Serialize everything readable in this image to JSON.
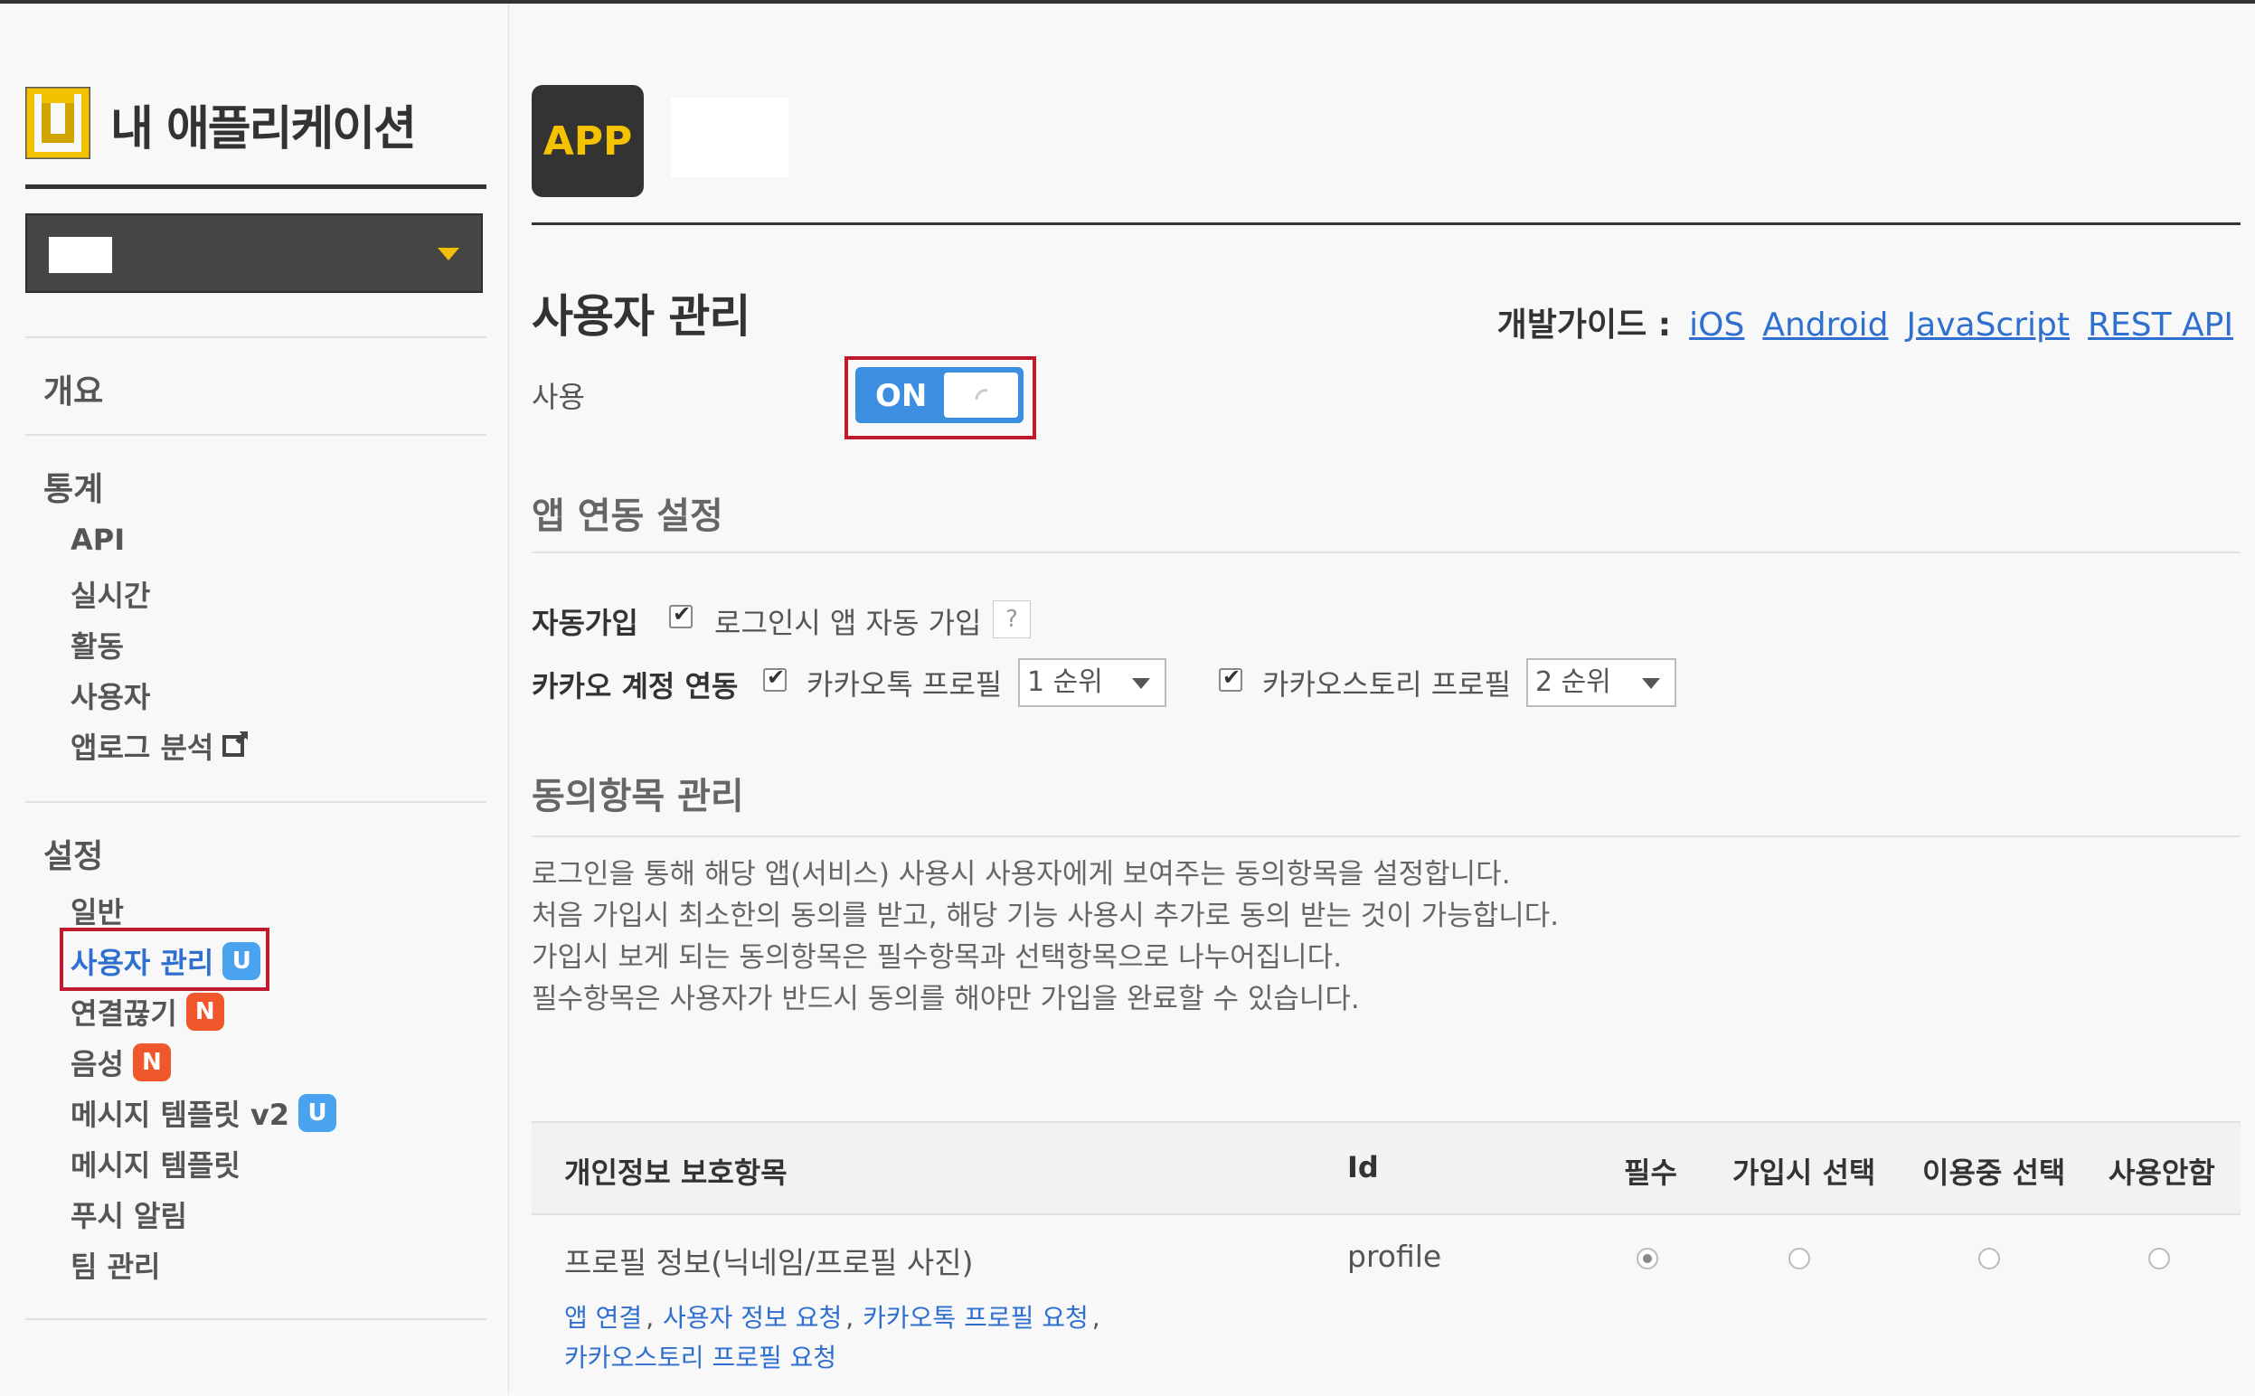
{
  "sidebar": {
    "title": "내 애플리케이션",
    "sections": {
      "overview": "개요",
      "stats": {
        "heading": "통계",
        "items": [
          "API",
          "실시간",
          "활동",
          "사용자",
          "앱로그 분석"
        ]
      },
      "settings": {
        "heading": "설정",
        "items": [
          {
            "label": "일반"
          },
          {
            "label": "사용자 관리",
            "badge": "U"
          },
          {
            "label": "연결끊기",
            "badge": "N"
          },
          {
            "label": "음성",
            "badge": "N"
          },
          {
            "label": "메시지 템플릿 v2",
            "badge": "U"
          },
          {
            "label": "메시지 템플릿"
          },
          {
            "label": "푸시 알림"
          },
          {
            "label": "팀 관리"
          }
        ]
      }
    }
  },
  "header": {
    "app_icon_text": "APP"
  },
  "page": {
    "title": "사용자 관리",
    "guide_label": "개발가이드 :",
    "guide_links": [
      "iOS",
      "Android",
      "JavaScript",
      "REST API"
    ],
    "use_label": "사용",
    "toggle_state": "ON"
  },
  "app_link": {
    "heading": "앱 연동 설정",
    "auto_join_label": "자동가입",
    "auto_join_checkbox": "로그인시 앱 자동 가입",
    "help": "?",
    "kakao_account_label": "카카오 계정 연동",
    "talk_profile_checkbox": "카카오톡 프로필",
    "talk_profile_rank": "1 순위",
    "story_profile_checkbox": "카카오스토리 프로필",
    "story_profile_rank": "2 순위"
  },
  "consent": {
    "heading": "동의항목 관리",
    "description": [
      "로그인을 통해 해당 앱(서비스) 사용시 사용자에게 보여주는 동의항목을 설정합니다.",
      "처음 가입시 최소한의 동의를 받고, 해당 기능 사용시 추가로 동의 받는 것이 가능합니다.",
      "가입시 보게 되는 동의항목은 필수항목과 선택항목으로 나누어집니다.",
      "필수항목은 사용자가 반드시 동의를 해야만 가입을 완료할 수 있습니다."
    ],
    "table": {
      "headers": [
        "개인정보 보호항목",
        "Id",
        "필수",
        "가입시 선택",
        "이용중 선택",
        "사용안함"
      ],
      "rows": [
        {
          "item": "프로필 정보(닉네임/프로필 사진)",
          "id": "profile",
          "selected": "필수",
          "links": [
            "앱 연결",
            "사용자 정보 요청",
            "카카오톡 프로필 요청",
            "카카오스토리 프로필 요청"
          ]
        }
      ]
    }
  }
}
